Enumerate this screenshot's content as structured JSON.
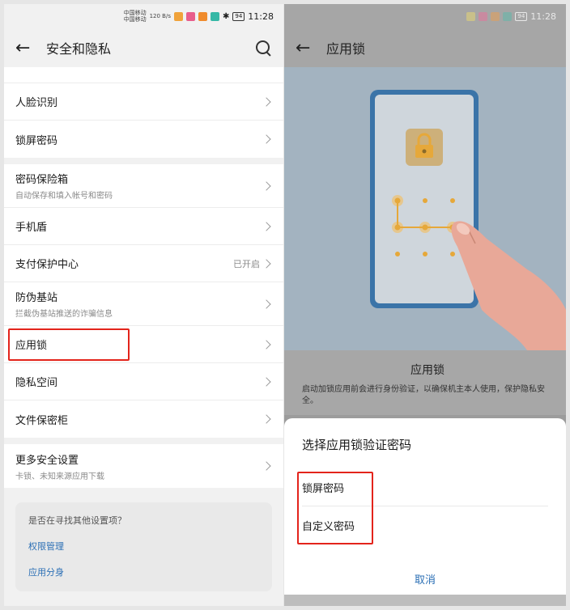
{
  "left": {
    "status": {
      "carrier1": "中国移动",
      "carrier2": "中国移动",
      "speed": "120 B/s",
      "battery": "94",
      "time": "11:28"
    },
    "title": "安全和隐私",
    "groups": [
      [
        {
          "label": "人脸识别"
        },
        {
          "label": "锁屏密码"
        }
      ],
      [
        {
          "label": "密码保险箱",
          "sub": "自动保存和填入帐号和密码"
        },
        {
          "label": "手机盾"
        },
        {
          "label": "支付保护中心",
          "value": "已开启"
        },
        {
          "label": "防伪基站",
          "sub": "拦截伪基站推送的诈骗信息"
        },
        {
          "label": "应用锁"
        },
        {
          "label": "隐私空间"
        },
        {
          "label": "文件保密柜"
        }
      ],
      [
        {
          "label": "更多安全设置",
          "sub": "卡锁、未知来源应用下载"
        }
      ]
    ],
    "suggest": {
      "question": "是否在寻找其他设置项？",
      "links": [
        "权限管理",
        "应用分身"
      ]
    }
  },
  "right": {
    "status": {
      "time": "11:28",
      "battery": "94"
    },
    "title": "应用锁",
    "info_title": "应用锁",
    "info_desc": "启动加锁应用前会进行身份验证，以确保机主本人使用，保护隐私安全。",
    "sheet_title": "选择应用锁验证密码",
    "options": [
      "锁屏密码",
      "自定义密码"
    ],
    "cancel": "取消"
  },
  "colors": {
    "highlight": "#e3241b",
    "link": "#2b6fb5",
    "illus_bg": "#a3b3c0",
    "phone_frame": "#3b74a8",
    "lock_orange": "#e6a83a"
  },
  "icons": [
    "back-arrow-icon",
    "search-icon",
    "chevron-right-icon",
    "lock-icon",
    "hand-icon"
  ]
}
